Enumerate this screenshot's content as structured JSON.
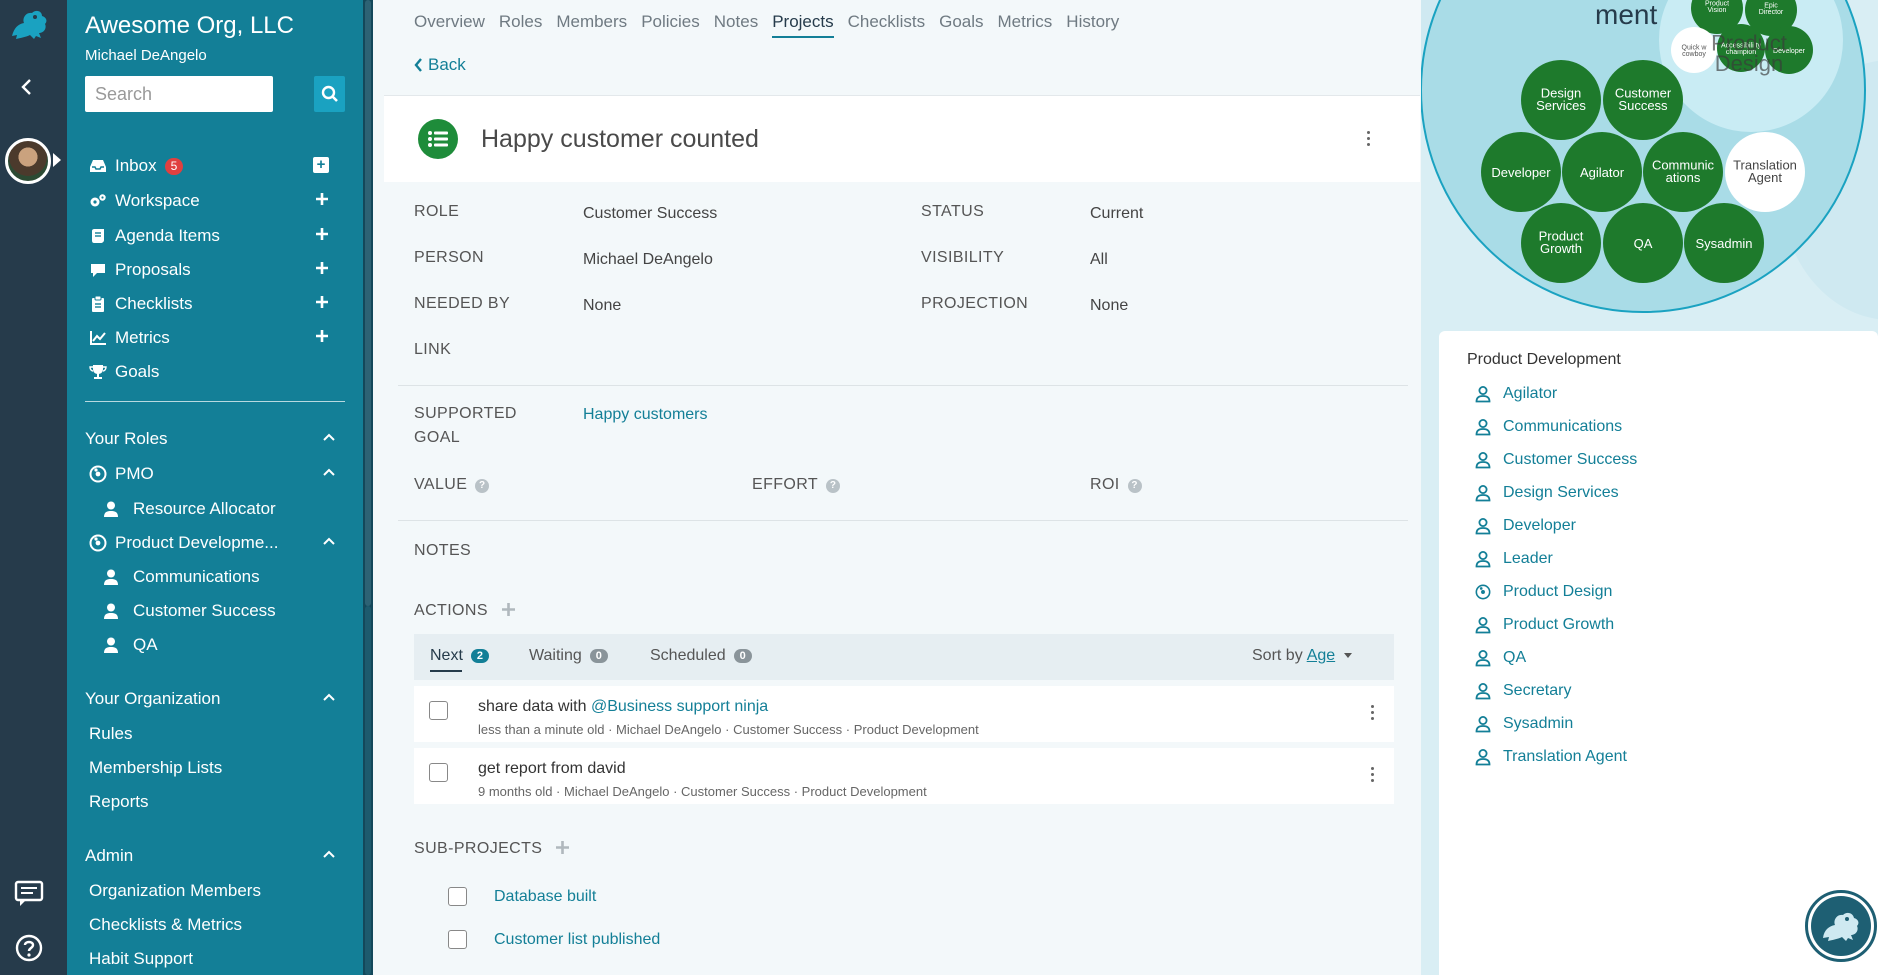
{
  "sidebar": {
    "org_name": "Awesome Org, LLC",
    "user_name": "Michael DeAngelo",
    "search_placeholder": "Search",
    "nav": [
      {
        "label": "Inbox",
        "badge": "5"
      },
      {
        "label": "Workspace"
      },
      {
        "label": "Agenda Items"
      },
      {
        "label": "Proposals"
      },
      {
        "label": "Checklists"
      },
      {
        "label": "Metrics"
      },
      {
        "label": "Goals"
      }
    ],
    "your_roles": {
      "heading": "Your Roles",
      "circles": [
        {
          "label": "PMO",
          "roles": [
            "Resource Allocator"
          ]
        },
        {
          "label": "Product Developme...",
          "roles": [
            "Communications",
            "Customer Success",
            "QA"
          ]
        }
      ]
    },
    "your_org": {
      "heading": "Your Organization",
      "links": [
        "Rules",
        "Membership Lists",
        "Reports"
      ]
    },
    "admin": {
      "heading": "Admin",
      "links": [
        "Organization Members",
        "Checklists & Metrics",
        "Habit Support"
      ]
    }
  },
  "main": {
    "tabs": [
      "Overview",
      "Roles",
      "Members",
      "Policies",
      "Notes",
      "Projects",
      "Checklists",
      "Goals",
      "Metrics",
      "History"
    ],
    "active_tab": "Projects",
    "back_label": "Back",
    "project_title": "Happy customer counted",
    "fields": {
      "role_label": "ROLE",
      "role_value": "Customer Success",
      "person_label": "PERSON",
      "person_value": "Michael DeAngelo",
      "needed_label": "NEEDED BY",
      "needed_value": "None",
      "link_label": "LINK",
      "status_label": "STATUS",
      "status_value": "Current",
      "visibility_label": "VISIBILITY",
      "visibility_value": "All",
      "projection_label": "PROJECTION",
      "projection_value": "None",
      "goal_label_1": "SUPPORTED",
      "goal_label_2": "GOAL",
      "goal_value": "Happy customers",
      "value_label": "VALUE",
      "effort_label": "EFFORT",
      "roi_label": "ROI",
      "notes_label": "NOTES",
      "actions_label": "ACTIONS",
      "subprojects_label": "SUB-PROJECTS"
    },
    "action_tabs": [
      {
        "label": "Next",
        "count": "2"
      },
      {
        "label": "Waiting",
        "count": "0"
      },
      {
        "label": "Scheduled",
        "count": "0"
      }
    ],
    "sort_by_label": "Sort by",
    "sort_by_value": "Age",
    "actions": [
      {
        "title": "share data with ",
        "mention": "@Business support ninja",
        "meta": "less than a minute old · Michael DeAngelo · Customer Success · Product Development"
      },
      {
        "title": "get report from david",
        "mention": "",
        "meta": "9 months old · Michael DeAngelo · Customer Success · Product Development"
      }
    ],
    "subprojects": [
      "Database built",
      "Customer list published"
    ]
  },
  "right": {
    "circle_partial_title": "ment",
    "overlay_text": "Product Design",
    "bubbles": {
      "top": [
        "Product Vision",
        "Epic Director",
        "Quick w cowboy",
        "Accessibili ty champion",
        "Developer"
      ],
      "design_services": "Design Services",
      "customer_success": "Customer Success",
      "developer": "Developer",
      "agilator": "Agilator",
      "communications": "Communic ations",
      "translation_agent": "Translation Agent",
      "product_growth": "Product Growth",
      "qa": "QA",
      "sysadmin": "Sysadmin"
    },
    "roles_heading": "Product Development",
    "roles": [
      "Agilator",
      "Communications",
      "Customer Success",
      "Design Services",
      "Developer",
      "Leader",
      "Product Design",
      "Product Growth",
      "QA",
      "Secretary",
      "Sysadmin",
      "Translation Agent"
    ],
    "role_kinds": [
      "person",
      "person",
      "person",
      "person",
      "person",
      "person",
      "circle",
      "person",
      "person",
      "person",
      "person",
      "person"
    ]
  },
  "colors": {
    "teal": "#137f97",
    "navy": "#263b4b",
    "green": "#1e7a2c",
    "red_badge": "#e04040"
  }
}
